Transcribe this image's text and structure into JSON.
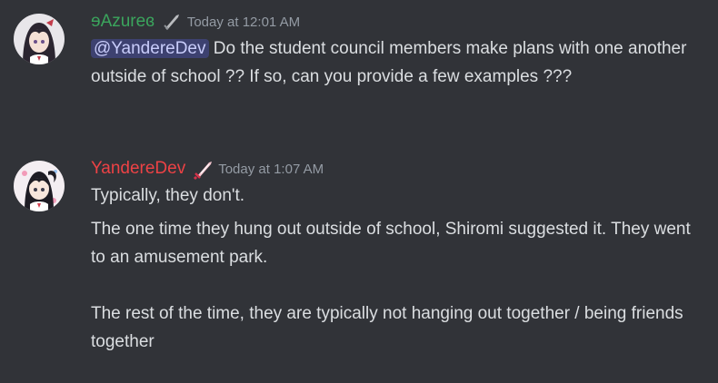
{
  "messages": [
    {
      "username": "ɘAzureɞ",
      "username_color": "#3ba55d",
      "role_icon": "sword-icon",
      "timestamp": "Today at 12:01 AM",
      "mention": "@YandereDev",
      "text_after_mention": " Do the student council members make plans with one another outside of school ?? If so, can you provide a few examples ???"
    },
    {
      "username": "YandereDev",
      "username_color": "#ed4245",
      "role_icon": "katana-icon",
      "timestamp": "Today at 1:07 AM",
      "paragraphs": [
        "Typically, they don't.",
        "The one time they hung out outside of school, Shiromi suggested it. They went to an amusement park.\n\nThe rest of the time, they are typically not hanging out together / being friends together"
      ]
    }
  ]
}
